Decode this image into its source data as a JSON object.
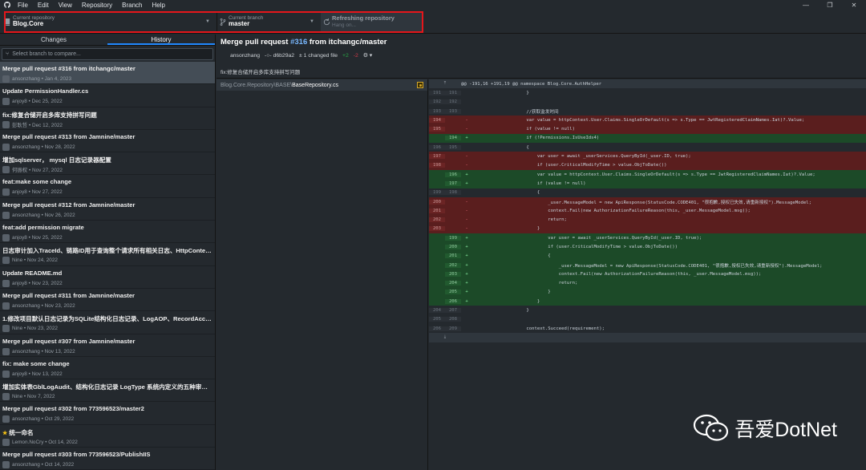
{
  "menu": [
    "File",
    "Edit",
    "View",
    "Repository",
    "Branch",
    "Help"
  ],
  "window_controls": [
    "—",
    "❐",
    "✕"
  ],
  "toolbar": {
    "repo_title": "Current repository",
    "repo_value": "Blog.Core",
    "branch_title": "Current branch",
    "branch_value": "master",
    "fetch_title": "Refreshing repository",
    "fetch_value": "Hang on..."
  },
  "sidebar": {
    "tabs": [
      "Changes",
      "History"
    ],
    "compare_placeholder": "Select branch to compare...",
    "commits": [
      {
        "title": "Merge pull request #316 from itchangc/master",
        "meta": "ansonzhang • Jan 4, 2023"
      },
      {
        "title": "Update PermissionHandler.cs",
        "meta": "anjoy8 • Dec 25, 2022"
      },
      {
        "title": "fix:修复合储开启多库支持拼写问题",
        "meta": "彭耿哲 • Dec 12, 2022"
      },
      {
        "title": "Merge pull request #313 from Jamnine/master",
        "meta": "ansonzhang • Nov 28, 2022"
      },
      {
        "title": "增加sqlserver， mysql 日志记录器配置",
        "meta": "何振权 • Nov 27, 2022"
      },
      {
        "title": "feat:make some change",
        "meta": "anjoy8 • Nov 27, 2022"
      },
      {
        "title": "Merge pull request #312 from Jamnine/master",
        "meta": "ansonzhang • Nov 26, 2022"
      },
      {
        "title": "feat:add permission migrate",
        "meta": "anjoy8 • Nov 25, 2022"
      },
      {
        "title": "日志审计加入TraceId、链路ID用于查询整个请求所有相关日志、HttpContext.Tra...",
        "meta": "Nine • Nov 24, 2022"
      },
      {
        "title": "Update README.md",
        "meta": "anjoy8 • Nov 23, 2022"
      },
      {
        "title": "Merge pull request #311 from Jamnine/master",
        "meta": "ansonzhang • Nov 23, 2022"
      },
      {
        "title": "1.修改项目默认日志记录为SQLite结构化日志记录、LogAOP、RecordAccessLog...",
        "meta": "Nine • Nov 23, 2022"
      },
      {
        "title": "Merge pull request #307 from Jamnine/master",
        "meta": "ansonzhang • Nov 13, 2022"
      },
      {
        "title": "fix: make some change",
        "meta": "anjoy8 • Nov 13, 2022"
      },
      {
        "title": "增加实体表GblLogAudit、结构化日志记录 LogType 系统内定义的五种审计日志A...",
        "meta": "Nine • Nov 7, 2022"
      },
      {
        "title": "Merge pull request #302 from 773596523/master2",
        "meta": "ansonzhang • Oct 29, 2022"
      },
      {
        "title": "统一命名",
        "meta": "Lemon.NoCry • Oct 14, 2022",
        "star": true
      },
      {
        "title": "Merge pull request #303 from 773596523/PublishIIS",
        "meta": "ansonzhang • Oct 14, 2022"
      }
    ]
  },
  "commit": {
    "title_prefix": "Merge pull request ",
    "pr": "#316",
    "title_suffix": " from itchangc/master",
    "author": "ansonzhang",
    "sha": "d6b29a2",
    "changed": "1 changed file",
    "adds": "+2",
    "dels": "-2",
    "description": "fix:修复合储开启多库支持拼写问题"
  },
  "file": {
    "path": "Blog.Core.Repository\\BASE\\",
    "name": "BaseRepository.cs"
  },
  "diff": {
    "hunk": "@@ -191,16 +191,19 @@ namespace Blog.Core.AuthHelper",
    "lines": [
      {
        "t": "ctx",
        "o": "191",
        "n": "191",
        "c": "                    }"
      },
      {
        "t": "ctx",
        "o": "192",
        "n": "192",
        "c": ""
      },
      {
        "t": "ctx",
        "o": "193",
        "n": "193",
        "c": "                    //获取监发时间"
      },
      {
        "t": "del",
        "o": "194",
        "n": "",
        "c": "                    var value = httpContext.User.Claims.SingleOrDefault(s => s.Type == JwtRegisteredClaimNames.Iat)?.Value;"
      },
      {
        "t": "del",
        "o": "195",
        "n": "",
        "c": "                    if (value != null)"
      },
      {
        "t": "add",
        "o": "",
        "n": "194",
        "c": "                    if (!Permissions.IsUseIds4)"
      },
      {
        "t": "ctx",
        "o": "196",
        "n": "195",
        "c": "                    {"
      },
      {
        "t": "del",
        "o": "197",
        "n": "",
        "c": "                        var user = await _userServices.QueryById(_user.ID, true);"
      },
      {
        "t": "del",
        "o": "198",
        "n": "",
        "c": "                        if (user.CriticalModifyTime > value.ObjToDate())"
      },
      {
        "t": "add",
        "o": "",
        "n": "196",
        "c": "                        var value = httpContext.User.Claims.SingleOrDefault(s => s.Type == JwtRegisteredClaimNames.Iat)?.Value;"
      },
      {
        "t": "add",
        "o": "",
        "n": "197",
        "c": "                        if (value != null)"
      },
      {
        "t": "ctx",
        "o": "199",
        "n": "198",
        "c": "                        {"
      },
      {
        "t": "del",
        "o": "200",
        "n": "",
        "c": "                            _user.MessageModel = new ApiResponse(StatusCode.CODE401, \"很抱歉,授权已失效,请重新授权\").MessageModel;"
      },
      {
        "t": "del",
        "o": "201",
        "n": "",
        "c": "                            context.Fail(new AuthorizationFailureReason(this, _user.MessageModel.msg));"
      },
      {
        "t": "del",
        "o": "202",
        "n": "",
        "c": "                            return;"
      },
      {
        "t": "del",
        "o": "203",
        "n": "",
        "c": "                        }"
      },
      {
        "t": "add",
        "o": "",
        "n": "199",
        "c": "                            var user = await _userServices.QueryById(_user.ID, true);"
      },
      {
        "t": "add",
        "o": "",
        "n": "200",
        "c": "                            if (user.CriticalModifyTime > value.ObjToDate())"
      },
      {
        "t": "add",
        "o": "",
        "n": "201",
        "c": "                            {"
      },
      {
        "t": "add",
        "o": "",
        "n": "202",
        "c": "                                _user.MessageModel = new ApiResponse(StatusCode.CODE401, \"很抱歉,授权已失效,请重新授权\").MessageModel;"
      },
      {
        "t": "add",
        "o": "",
        "n": "203",
        "c": "                                context.Fail(new AuthorizationFailureReason(this, _user.MessageModel.msg));"
      },
      {
        "t": "add",
        "o": "",
        "n": "204",
        "c": "                                return;"
      },
      {
        "t": "add",
        "o": "",
        "n": "205",
        "c": "                            }"
      },
      {
        "t": "add",
        "o": "",
        "n": "206",
        "c": "                        }"
      },
      {
        "t": "ctx",
        "o": "204",
        "n": "207",
        "c": "                    }"
      },
      {
        "t": "ctx",
        "o": "205",
        "n": "208",
        "c": ""
      },
      {
        "t": "ctx",
        "o": "206",
        "n": "209",
        "c": "                    context.Succeed(requirement);"
      }
    ]
  },
  "watermark": "吾爱DotNet"
}
